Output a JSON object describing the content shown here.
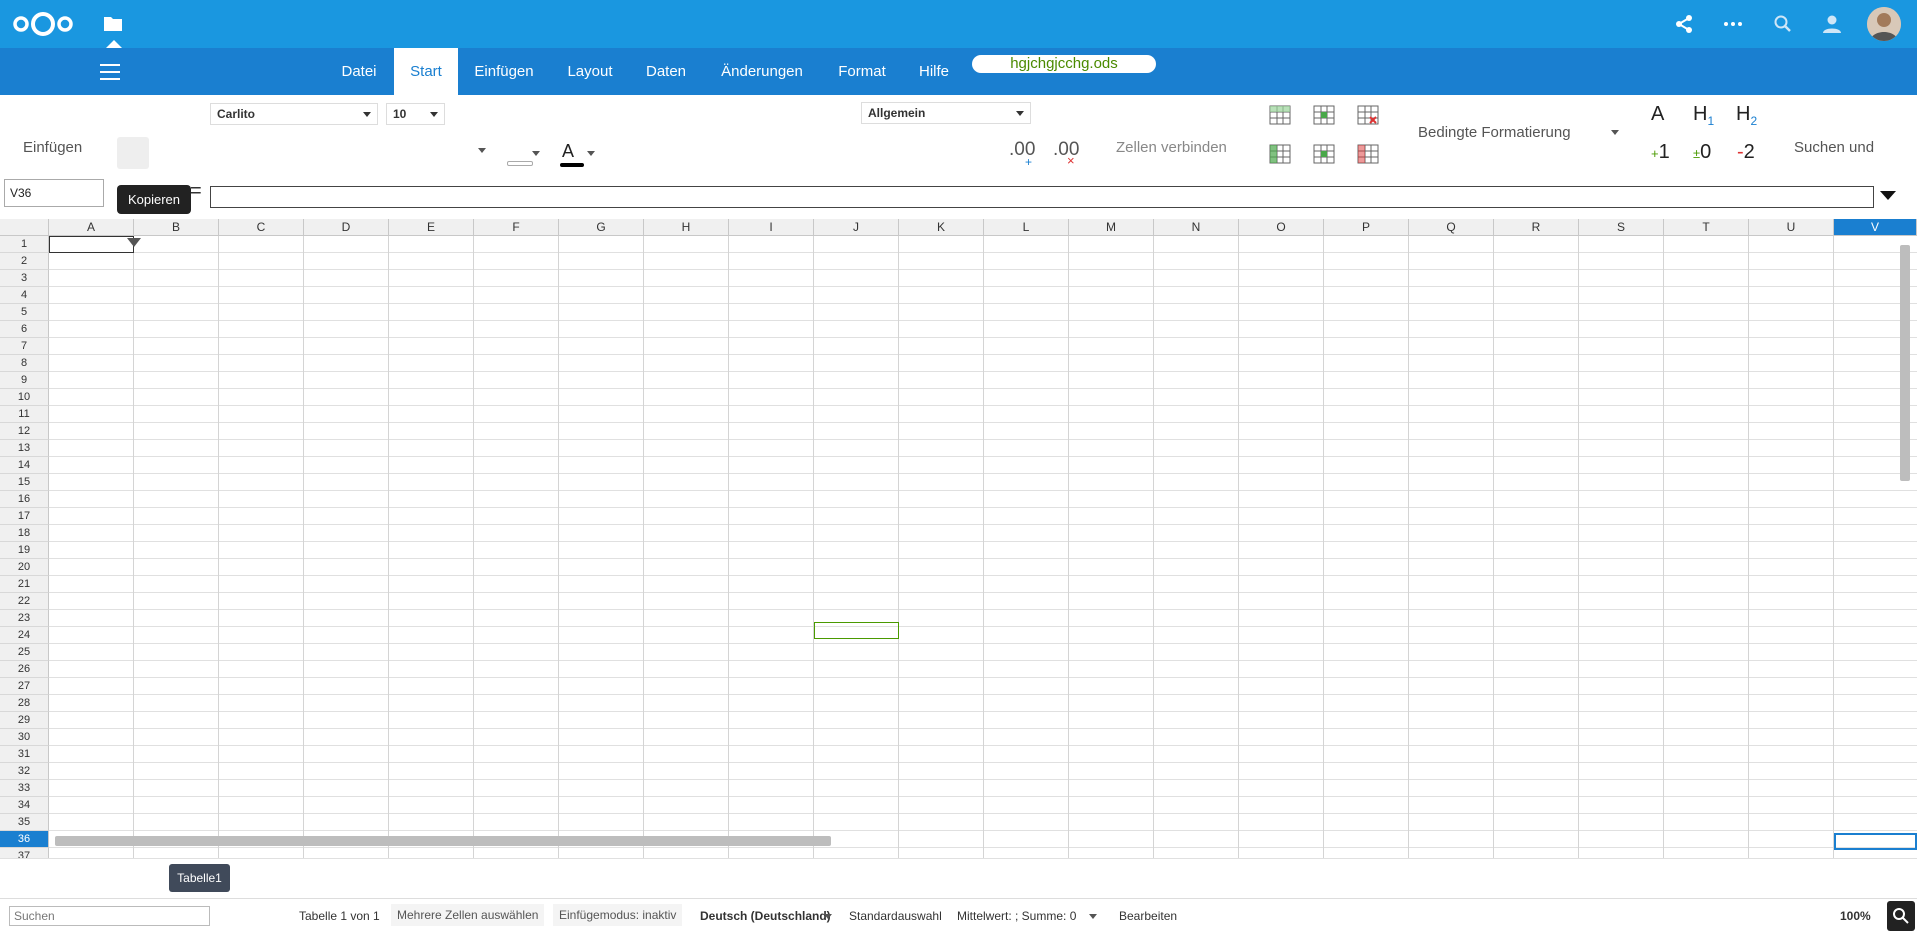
{
  "topbar": {
    "icons": [
      "nextcloud-logo",
      "files-icon",
      "share-icon",
      "more-icon",
      "search-icon",
      "contacts-icon",
      "user-avatar"
    ]
  },
  "menu": {
    "tabs": [
      "Datei",
      "Start",
      "Einfügen",
      "Layout",
      "Daten",
      "Änderungen",
      "Format",
      "Hilfe"
    ],
    "active_tab": "Start",
    "filename": "hgjchgjcchg.ods"
  },
  "ribbon": {
    "paste_label": "Einfügen",
    "font_name": "Carlito",
    "font_size": "10",
    "number_format": "Allgemein",
    "merge_label": "Zellen verbinden",
    "conditional_label": "Bedingte Formatierung",
    "style_labels": [
      "A",
      "H1",
      "H2"
    ],
    "style_labels_2": [
      "+1",
      "±0",
      "-2"
    ],
    "find_label": "Suchen und",
    "decimal_add": ".00",
    "decimal_remove": ".00",
    "font_color_letter": "A"
  },
  "formula": {
    "cell_address": "V36",
    "tooltip": "Kopieren",
    "equals": "=",
    "content": ""
  },
  "grid": {
    "columns": [
      "A",
      "B",
      "C",
      "D",
      "E",
      "F",
      "G",
      "H",
      "I",
      "J",
      "K",
      "L",
      "M",
      "N",
      "O",
      "P",
      "Q",
      "R",
      "S",
      "T",
      "U",
      "V"
    ],
    "selected_column": "V",
    "rows": [
      "1",
      "2",
      "3",
      "4",
      "5",
      "6",
      "7",
      "8",
      "9",
      "10",
      "11",
      "12",
      "13",
      "14",
      "15",
      "16",
      "17",
      "18",
      "19",
      "20",
      "21",
      "22",
      "23",
      "24",
      "25",
      "26",
      "27",
      "28",
      "29",
      "30",
      "31",
      "32",
      "33",
      "34",
      "35",
      "36",
      "37"
    ],
    "selected_row": "36"
  },
  "sheets": {
    "tabs": [
      "Tabelle1"
    ]
  },
  "statusbar": {
    "search_placeholder": "Suchen",
    "sheet_info": "Tabelle 1 von 1",
    "selection_mode": "Mehrere Zellen auswählen",
    "insert_mode": "Einfügemodus: inaktiv",
    "language": "Deutsch (Deutschland)",
    "selection_type": "Standardauswahl",
    "aggregate": "Mittelwert: ; Summe: 0",
    "edit_mode": "Bearbeiten",
    "zoom": "100%"
  },
  "colors": {
    "topbar": "#1a97e0",
    "menubar": "#1a7fd0",
    "filename_text": "#4a8a00",
    "selection": "#1a7fd0"
  }
}
